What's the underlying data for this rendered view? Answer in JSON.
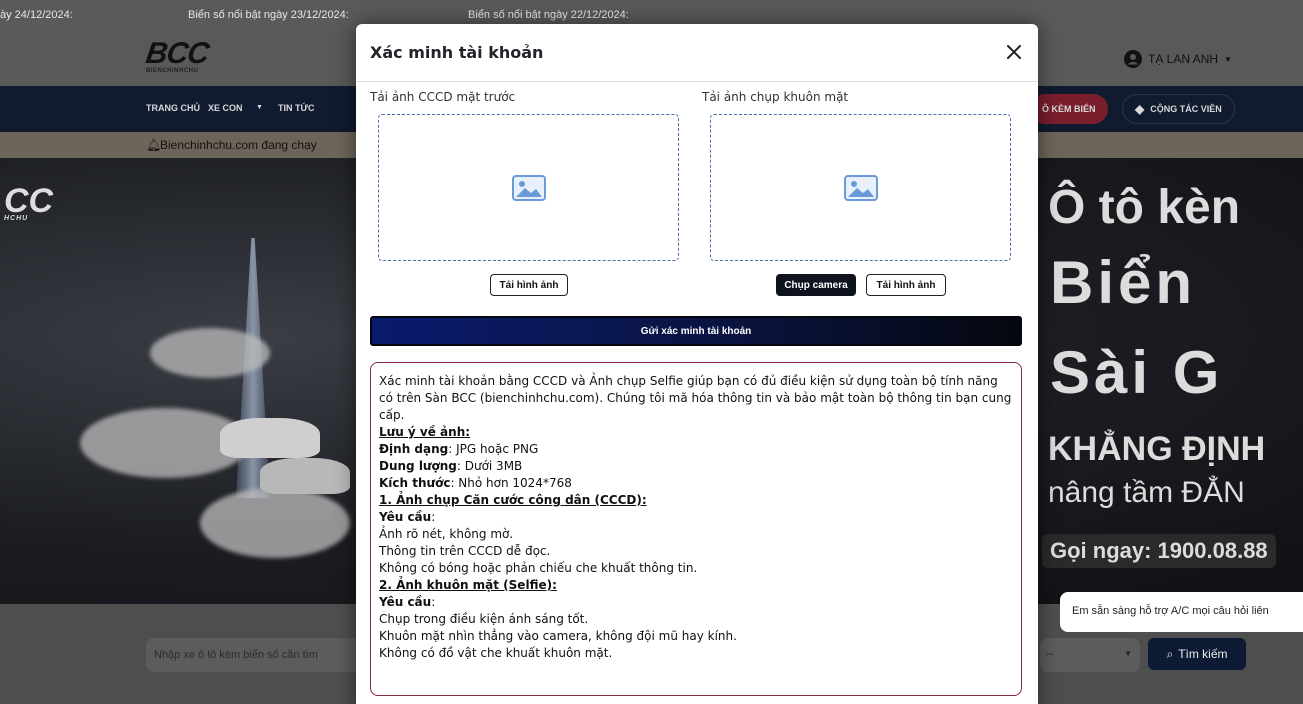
{
  "ticker": {
    "items": [
      "ày 24/12/2024:",
      "Biển số nổi bật ngày 23/12/2024:",
      "Biển số nổi bật ngày 22/12/2024:"
    ]
  },
  "header": {
    "logo_text": "BCC",
    "logo_sub": "BIENCHINHCHU",
    "user_name": "TẠ LAN ANH"
  },
  "nav": {
    "items": [
      "TRANG CHỦ",
      "XE CON",
      "TIN TỨC"
    ],
    "pill_left": "Ô KÈM BIỂN",
    "pill_right": "CỘNG TÁC VIÊN"
  },
  "notice": {
    "text": "Bienchinhchu.com đang chạy"
  },
  "hero": {
    "logo": "CC",
    "logo_sub": "HCHU",
    "line1": "Ô tô kèn",
    "line2": "Biển",
    "line3": "Sài G",
    "line4": "KHẲNG ĐỊNH",
    "line5": "nâng tầm ĐẲN",
    "line6": "Gọi ngay: 1900.08.88"
  },
  "search": {
    "placeholder": "Nhập xe ô tô kèm biển số cần tìm",
    "select_value": "--",
    "button_label": "Tìm kiếm"
  },
  "chat": {
    "text": "Em sẵn sàng hỗ trợ A/C mọi câu hỏi liên"
  },
  "modal": {
    "title": "Xác minh tài khoản",
    "front_label": "Tải ảnh CCCD mặt trước",
    "face_label": "Tải ảnh chụp khuôn mặt",
    "upload_label": "Tải hình ảnh",
    "camera_label": "Chụp camera",
    "upload_label_2": "Tải hình ảnh",
    "submit_label": "Gửi xác minh tài khoản",
    "info": {
      "intro": "Xác minh tài khoản bằng CCCD và Ảnh chụp Selfie giúp bạn có đủ điều kiện sử dụng toàn bộ tính năng có trên Sàn BCC (bienchinhchu.com). Chúng tôi mã hóa thông tin và bảo mật toàn bộ thông tin bạn cung cấp.",
      "note_heading": "Lưu ý về ảnh:",
      "format_label": "Định dạng",
      "format_value": ": JPG hoặc PNG",
      "size_label": "Dung lượng",
      "size_value": ": Dưới 3MB",
      "dim_label": "Kích thước",
      "dim_value": ": Nhỏ hơn 1024*768",
      "sec1_heading": "1. Ảnh chụp Căn cước công dân (CCCD):",
      "sec1_req": "Yêu cầu",
      "sec1_lines": [
        "Ảnh rõ nét, không mờ.",
        "Thông tin trên CCCD dễ đọc.",
        "Không có bóng hoặc phản chiếu che khuất thông tin."
      ],
      "sec2_heading": "2. Ảnh khuôn mặt (Selfie):",
      "sec2_req": "Yêu cầu",
      "sec2_lines": [
        "Chụp trong điều kiện ánh sáng tốt.",
        "Khuôn mặt nhìn thẳng vào camera, không đội mũ hay kính.",
        "Không có đồ vật che khuất khuôn mặt."
      ]
    }
  }
}
